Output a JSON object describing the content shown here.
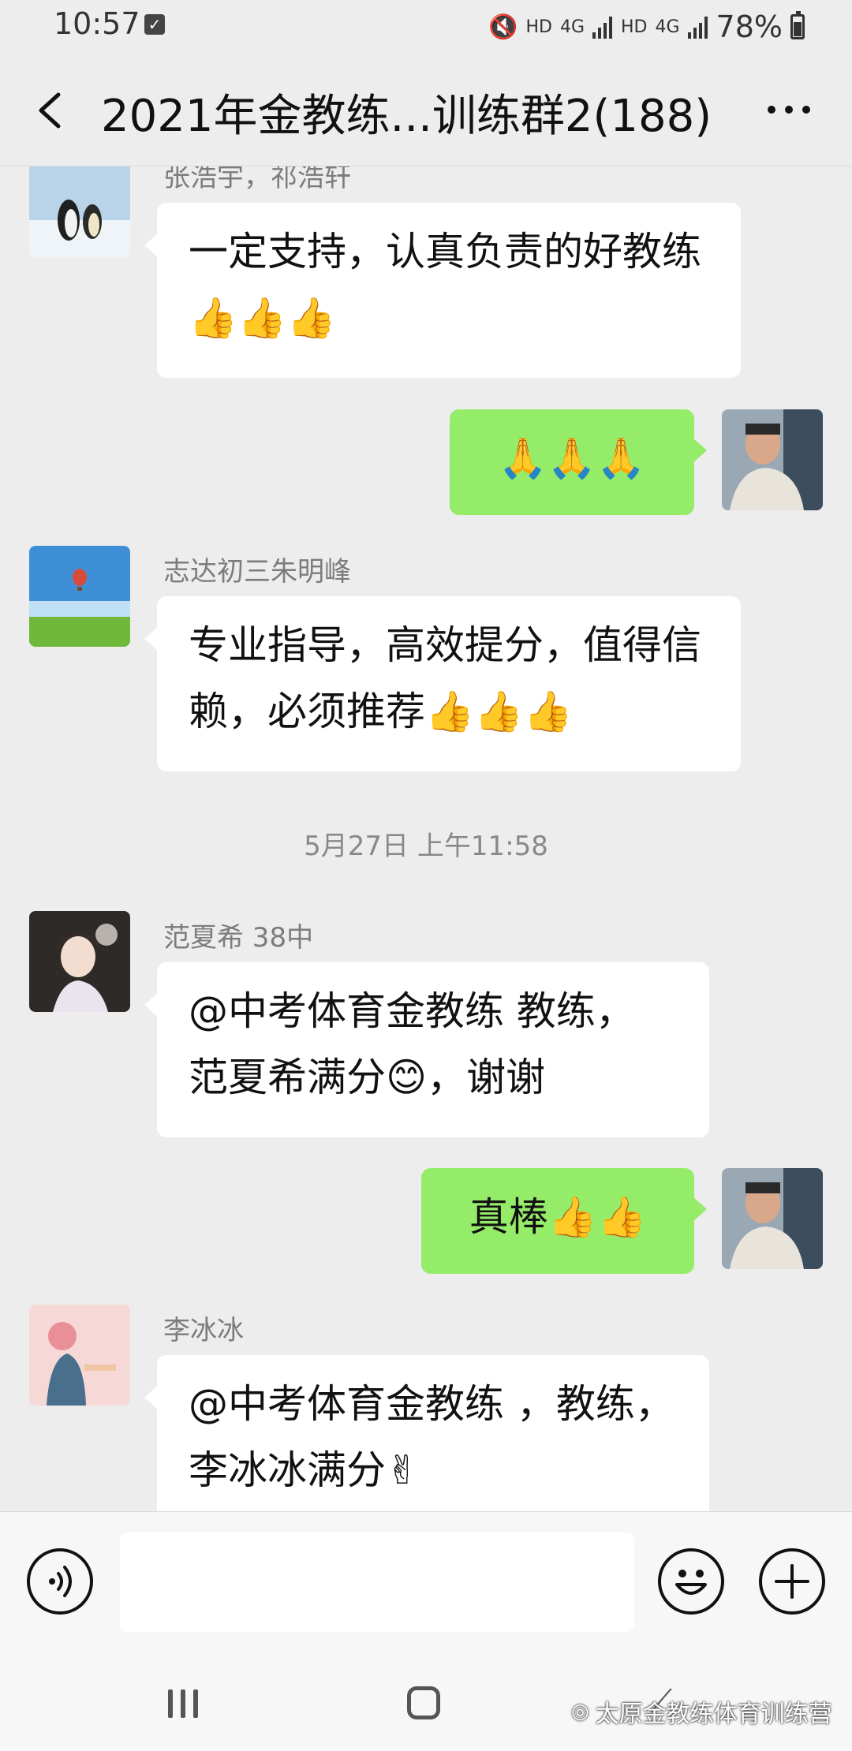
{
  "status_bar": {
    "time": "10:57",
    "hd1": "HD",
    "net1": "4G",
    "hd2": "HD",
    "net2": "4G",
    "battery": "78%"
  },
  "header": {
    "title": "2021年金教练...训练群2(188)"
  },
  "messages": [
    {
      "side": "left",
      "sender": "张浩宇，祁浩轩",
      "text": "一定支持，认真负责的好教练👍👍👍"
    },
    {
      "side": "right",
      "text": "🙏🙏🙏"
    },
    {
      "side": "left",
      "sender": "志达初三朱明峰",
      "text": "专业指导，高效提分，值得信赖，必须推荐👍👍👍"
    },
    {
      "side": "timestamp",
      "text": "5月27日 上午11:58"
    },
    {
      "side": "left",
      "sender": "范夏希 38中",
      "line1": "@中考体育金教练  教练，",
      "line2": "范夏希满分😊，谢谢"
    },
    {
      "side": "right",
      "text": "真棒👍👍"
    },
    {
      "side": "left",
      "sender": "李冰冰",
      "line1": "@中考体育金教练 ，教练，",
      "line2": "李冰冰满分✌"
    }
  ],
  "input_bar": {
    "voice_icon": "voice-icon",
    "emoji_icon": "emoji-icon",
    "plus_icon": "plus-icon"
  },
  "watermark": "太原金教练体育训练营",
  "colors": {
    "background": "#ededed",
    "self_bubble": "#95ec69",
    "other_bubble": "#ffffff"
  }
}
